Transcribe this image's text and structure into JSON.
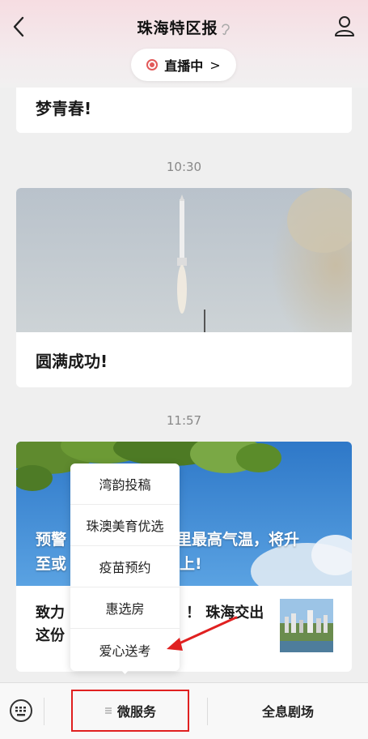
{
  "header": {
    "title": "珠海特区报",
    "live_label": "直播中",
    "live_chevron": ">"
  },
  "feed": {
    "card1_text": "梦青春!",
    "time1": "10:30",
    "card2_text": "圆满成功!",
    "time2": "11:57",
    "card3_overlay": "预警 里最高气温，将升至或 上!",
    "card3_overlay_line1_left": "预警",
    "card3_overlay_line1_right": "里最高气温，将升",
    "card3_overlay_line2_left": "至或",
    "card3_overlay_line2_right": "上!",
    "card3_title_line1_left": "致力",
    "card3_title_line1_right": "！ 珠海交出",
    "card3_title_line2_left": "这份"
  },
  "popup": {
    "items": [
      "湾韵投稿",
      "珠澳美育优选",
      "疫苗预约",
      "惠选房",
      "爱心送考"
    ]
  },
  "bottombar": {
    "menu1_label": "微服务",
    "menu2_label": "全息剧场"
  },
  "colors": {
    "accent_red": "#e02020",
    "live_red": "#e25a5a"
  }
}
